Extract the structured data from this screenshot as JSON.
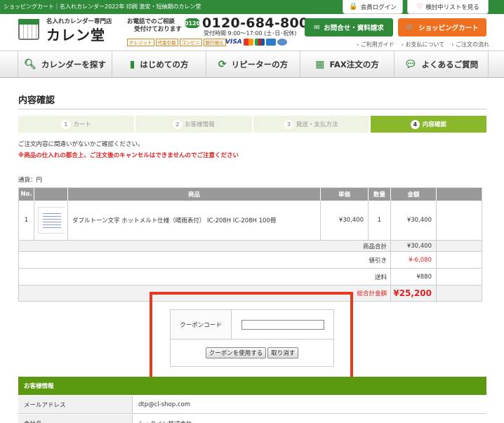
{
  "topbar": {
    "tagline": "ショッピングカート｜名入れカレンダー2022年 印刷 激安・短納期のカレン堂",
    "login": "会員ログイン",
    "wishlist": "検討中リストを見る"
  },
  "header": {
    "logo_sub": "名入れカレンダー専門店",
    "logo_main": "カレン堂",
    "consult_line1": "お電話でのご相談",
    "consult_line2": "受付けております",
    "freedial_mark": "0120",
    "phone": "0120-684-800",
    "hours": "受付時間 9:00～17:00 (土･日･祝休)",
    "payment_badges": [
      "クレジット",
      "代金引換",
      "コンビニ",
      "銀行振込"
    ],
    "card_brand": "VISA",
    "contact_button": "お問合せ・資料請求",
    "cart_button": "ショッピングカート",
    "sublinks": [
      "ご利用ガイド",
      "お支払について",
      "ご注文の流れ"
    ]
  },
  "nav": [
    {
      "label": "カレンダーを探す",
      "icon": "search-icon"
    },
    {
      "label": "はじめての方",
      "icon": "beginner-icon"
    },
    {
      "label": "リピーターの方",
      "icon": "repeat-icon"
    },
    {
      "label": "FAX注文の方",
      "icon": "fax-icon"
    },
    {
      "label": "よくあるご質問",
      "icon": "chat-icon"
    }
  ],
  "page": {
    "title": "内容確認",
    "notice": "ご注文内容に間違いがないかご確認ください。",
    "warning": "※商品の仕入れの都合上、ご注文後のキャンセルはできませんのでご注意ください",
    "currency": "通貨：円"
  },
  "steps": [
    {
      "num": "1",
      "label": "カート"
    },
    {
      "num": "2",
      "label": "お客様情報"
    },
    {
      "num": "3",
      "label": "発送・支払方法"
    },
    {
      "num": "4",
      "label": "内容確認"
    }
  ],
  "table": {
    "headers": {
      "no": "No.",
      "product": "商品",
      "price": "単価",
      "qty": "数量",
      "amount": "金額"
    },
    "rows": [
      {
        "no": "1",
        "name": "ダブルトーン文字 ホットメルト仕様（晴雨表付） IC-208H IC-208H 100冊",
        "price": "¥30,400",
        "qty": "1",
        "amount": "¥30,400"
      }
    ],
    "subtotal_label": "商品合計",
    "subtotal": "¥30,400",
    "discount_label": "値引き",
    "discount": "¥-6,080",
    "shipping_label": "送料",
    "shipping": "¥880",
    "total_label": "総合計金額",
    "total": "¥25,200"
  },
  "coupon": {
    "label": "クーポンコード",
    "value": "",
    "apply": "クーポンを使用する",
    "cancel": "取り消す"
  },
  "customer": {
    "header": "お客様情報",
    "rows": [
      {
        "key": "メールアドレス",
        "value": "dtp@cl-shop.com"
      },
      {
        "key": "会社名",
        "value": "シュライン株式会社"
      }
    ]
  },
  "colors": {
    "brand_green": "#2f8a3a",
    "accent_orange": "#f07020",
    "step_active": "#8ab82a",
    "warning_red": "#e02020",
    "highlight": "#e8391c"
  }
}
